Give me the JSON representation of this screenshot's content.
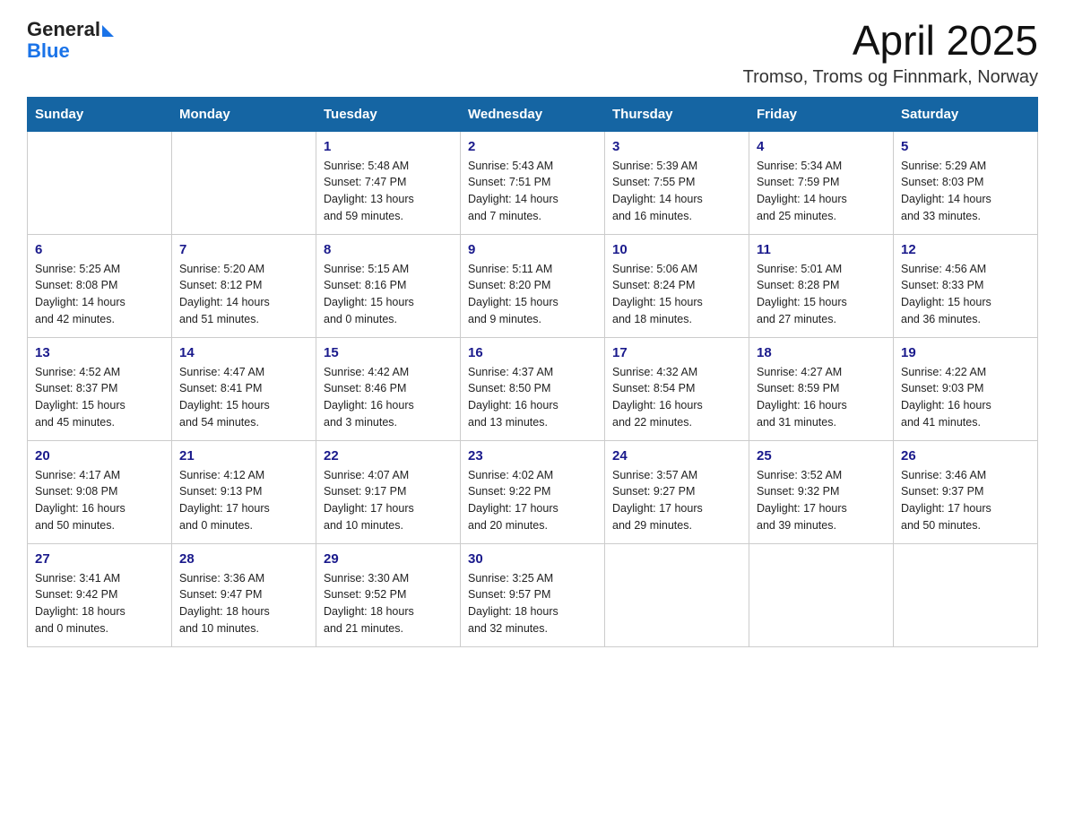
{
  "header": {
    "logo_general": "General",
    "logo_blue": "Blue",
    "month_year": "April 2025",
    "location": "Tromso, Troms og Finnmark, Norway"
  },
  "days_of_week": [
    "Sunday",
    "Monday",
    "Tuesday",
    "Wednesday",
    "Thursday",
    "Friday",
    "Saturday"
  ],
  "weeks": [
    [
      {
        "day": "",
        "info": ""
      },
      {
        "day": "",
        "info": ""
      },
      {
        "day": "1",
        "info": "Sunrise: 5:48 AM\nSunset: 7:47 PM\nDaylight: 13 hours\nand 59 minutes."
      },
      {
        "day": "2",
        "info": "Sunrise: 5:43 AM\nSunset: 7:51 PM\nDaylight: 14 hours\nand 7 minutes."
      },
      {
        "day": "3",
        "info": "Sunrise: 5:39 AM\nSunset: 7:55 PM\nDaylight: 14 hours\nand 16 minutes."
      },
      {
        "day": "4",
        "info": "Sunrise: 5:34 AM\nSunset: 7:59 PM\nDaylight: 14 hours\nand 25 minutes."
      },
      {
        "day": "5",
        "info": "Sunrise: 5:29 AM\nSunset: 8:03 PM\nDaylight: 14 hours\nand 33 minutes."
      }
    ],
    [
      {
        "day": "6",
        "info": "Sunrise: 5:25 AM\nSunset: 8:08 PM\nDaylight: 14 hours\nand 42 minutes."
      },
      {
        "day": "7",
        "info": "Sunrise: 5:20 AM\nSunset: 8:12 PM\nDaylight: 14 hours\nand 51 minutes."
      },
      {
        "day": "8",
        "info": "Sunrise: 5:15 AM\nSunset: 8:16 PM\nDaylight: 15 hours\nand 0 minutes."
      },
      {
        "day": "9",
        "info": "Sunrise: 5:11 AM\nSunset: 8:20 PM\nDaylight: 15 hours\nand 9 minutes."
      },
      {
        "day": "10",
        "info": "Sunrise: 5:06 AM\nSunset: 8:24 PM\nDaylight: 15 hours\nand 18 minutes."
      },
      {
        "day": "11",
        "info": "Sunrise: 5:01 AM\nSunset: 8:28 PM\nDaylight: 15 hours\nand 27 minutes."
      },
      {
        "day": "12",
        "info": "Sunrise: 4:56 AM\nSunset: 8:33 PM\nDaylight: 15 hours\nand 36 minutes."
      }
    ],
    [
      {
        "day": "13",
        "info": "Sunrise: 4:52 AM\nSunset: 8:37 PM\nDaylight: 15 hours\nand 45 minutes."
      },
      {
        "day": "14",
        "info": "Sunrise: 4:47 AM\nSunset: 8:41 PM\nDaylight: 15 hours\nand 54 minutes."
      },
      {
        "day": "15",
        "info": "Sunrise: 4:42 AM\nSunset: 8:46 PM\nDaylight: 16 hours\nand 3 minutes."
      },
      {
        "day": "16",
        "info": "Sunrise: 4:37 AM\nSunset: 8:50 PM\nDaylight: 16 hours\nand 13 minutes."
      },
      {
        "day": "17",
        "info": "Sunrise: 4:32 AM\nSunset: 8:54 PM\nDaylight: 16 hours\nand 22 minutes."
      },
      {
        "day": "18",
        "info": "Sunrise: 4:27 AM\nSunset: 8:59 PM\nDaylight: 16 hours\nand 31 minutes."
      },
      {
        "day": "19",
        "info": "Sunrise: 4:22 AM\nSunset: 9:03 PM\nDaylight: 16 hours\nand 41 minutes."
      }
    ],
    [
      {
        "day": "20",
        "info": "Sunrise: 4:17 AM\nSunset: 9:08 PM\nDaylight: 16 hours\nand 50 minutes."
      },
      {
        "day": "21",
        "info": "Sunrise: 4:12 AM\nSunset: 9:13 PM\nDaylight: 17 hours\nand 0 minutes."
      },
      {
        "day": "22",
        "info": "Sunrise: 4:07 AM\nSunset: 9:17 PM\nDaylight: 17 hours\nand 10 minutes."
      },
      {
        "day": "23",
        "info": "Sunrise: 4:02 AM\nSunset: 9:22 PM\nDaylight: 17 hours\nand 20 minutes."
      },
      {
        "day": "24",
        "info": "Sunrise: 3:57 AM\nSunset: 9:27 PM\nDaylight: 17 hours\nand 29 minutes."
      },
      {
        "day": "25",
        "info": "Sunrise: 3:52 AM\nSunset: 9:32 PM\nDaylight: 17 hours\nand 39 minutes."
      },
      {
        "day": "26",
        "info": "Sunrise: 3:46 AM\nSunset: 9:37 PM\nDaylight: 17 hours\nand 50 minutes."
      }
    ],
    [
      {
        "day": "27",
        "info": "Sunrise: 3:41 AM\nSunset: 9:42 PM\nDaylight: 18 hours\nand 0 minutes."
      },
      {
        "day": "28",
        "info": "Sunrise: 3:36 AM\nSunset: 9:47 PM\nDaylight: 18 hours\nand 10 minutes."
      },
      {
        "day": "29",
        "info": "Sunrise: 3:30 AM\nSunset: 9:52 PM\nDaylight: 18 hours\nand 21 minutes."
      },
      {
        "day": "30",
        "info": "Sunrise: 3:25 AM\nSunset: 9:57 PM\nDaylight: 18 hours\nand 32 minutes."
      },
      {
        "day": "",
        "info": ""
      },
      {
        "day": "",
        "info": ""
      },
      {
        "day": "",
        "info": ""
      }
    ]
  ]
}
